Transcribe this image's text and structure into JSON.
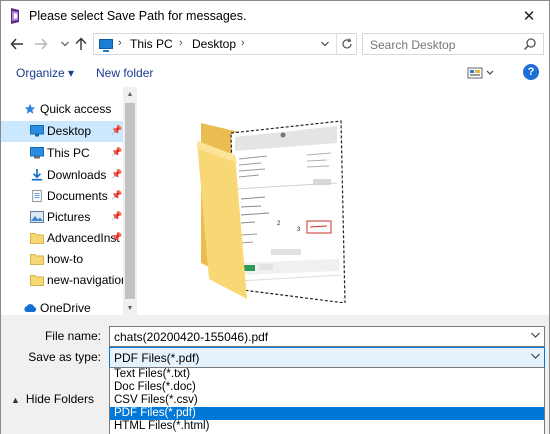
{
  "window": {
    "title": "Please select Save Path for messages.",
    "close_glyph": "✕"
  },
  "address_bar": {
    "crumbs": [
      "This PC",
      "Desktop"
    ],
    "separator": "›",
    "location_icon": "pc-icon"
  },
  "search": {
    "placeholder": "Search Desktop"
  },
  "toolbar": {
    "organize_label": "Organize ▾",
    "new_folder_label": "New folder",
    "help_label": "?"
  },
  "nav_pane": {
    "items": [
      {
        "label": "Quick access",
        "icon": "star-icon"
      },
      {
        "label": "Desktop",
        "icon": "desktop-icon",
        "selected": true,
        "pinned": true
      },
      {
        "label": "This PC",
        "icon": "pc-icon",
        "pinned": true
      },
      {
        "label": "Downloads",
        "icon": "download-icon",
        "pinned": true
      },
      {
        "label": "Documents",
        "icon": "documents-icon",
        "pinned": true
      },
      {
        "label": "Pictures",
        "icon": "pictures-icon",
        "pinned": true
      },
      {
        "label": "AdvancedInst",
        "icon": "folder-icon",
        "pinned": true
      },
      {
        "label": "how-to",
        "icon": "folder-icon"
      },
      {
        "label": "new-navigation-",
        "icon": "folder-icon"
      },
      {
        "label": "OneDrive",
        "icon": "cloud-icon"
      }
    ]
  },
  "form": {
    "file_name_label": "File name:",
    "file_name_value": "chats(20200420-155046).pdf",
    "save_as_type_label": "Save as type:",
    "save_as_type_value": "PDF Files(*.pdf)",
    "hide_folders_label": "Hide Folders"
  },
  "type_options": [
    {
      "label": "Text Files(*.txt)"
    },
    {
      "label": "Doc Files(*.doc)"
    },
    {
      "label": "CSV Files(*.csv)"
    },
    {
      "label": "PDF Files(*.pdf)",
      "selected": true
    },
    {
      "label": "HTML Files(*.html)"
    }
  ],
  "colors": {
    "selection_blue": "#0078d7",
    "nav_selected": "#cce8ff",
    "link_blue": "#1a3d8f",
    "folder_yellow": "#f8d775"
  }
}
